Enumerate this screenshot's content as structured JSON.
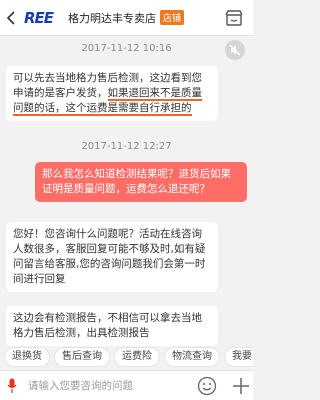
{
  "header": {
    "logo": "REE",
    "shop_name": "格力明达丰专卖店",
    "badge": "店铺"
  },
  "messages": [
    {
      "type": "time",
      "text": "2017-11-12 10:16"
    },
    {
      "type": "in",
      "parts": [
        "可以先去当地格力售后检测，这边看到您申请的是客户发货，",
        "如果退回来不是质量问题的话，这个运费是需要自行承担的"
      ]
    },
    {
      "type": "time",
      "text": "2017-11-12 12:27"
    },
    {
      "type": "out",
      "text": "那么我怎么知道检测结果呢？退货后如果证明是质量问题，运费怎么退还呢？"
    },
    {
      "type": "in",
      "text": "您好！您咨询什么问题呢？活动在线咨询人数很多，客服回复可能不够及时,如有疑问留言给客服,您的咨询问题我们会第一时间进行回复"
    },
    {
      "type": "in",
      "text": "这边会有检测报告，不相信可以拿去当地格力售后检测，出具检测报告"
    }
  ],
  "quick_tags": [
    "退换货",
    "售后查询",
    "运费险",
    "物流查询",
    "我要"
  ],
  "input": {
    "placeholder": "请输入您要咨询的问题"
  },
  "colors": {
    "accent": "#ff6d66",
    "underline": "#f26522",
    "badge": "#f0781e",
    "logo": "#1a3fa8"
  },
  "icons": [
    "back-icon",
    "shop-icon",
    "mute-icon",
    "mic-icon",
    "smile-icon",
    "plus-icon"
  ]
}
